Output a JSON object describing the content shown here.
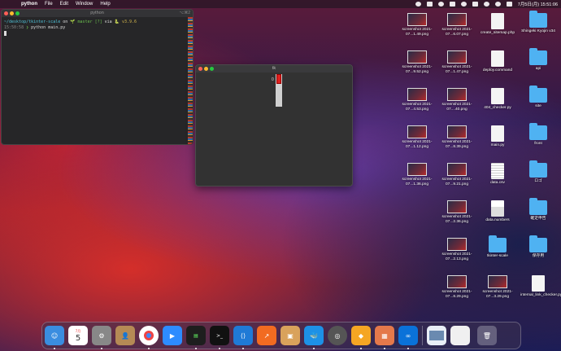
{
  "menubar": {
    "app": "python",
    "items": [
      "File",
      "Edit",
      "Window",
      "Help"
    ],
    "clock": "7月5日(月) 15:51:06"
  },
  "terminal": {
    "title": "python",
    "shortcut": "⌥⌘2",
    "line1": {
      "path": "~/desktop/tkinter-scale",
      "on": " on ",
      "branch": "🌱 master [?]",
      "via": " via ",
      "py": "🐍 v3.9.6"
    },
    "line2": {
      "time": "15:50:58",
      "prompt": " ❯ ",
      "cmd": "python main.py"
    }
  },
  "tk": {
    "title": "tk",
    "scale_value": "0",
    "scale_fraction": 0
  },
  "icons": [
    {
      "label": "screenshot 2021-07...1.49.png",
      "type": "thumb"
    },
    {
      "label": "screenshot 2021-07...6.07.png",
      "type": "thumb"
    },
    {
      "label": "create_sitemap.php",
      "type": "doc"
    },
    {
      "label": "Shingeki Kyojin v34",
      "type": "folder"
    },
    {
      "label": "screenshot 2021-07...9.52.png",
      "type": "thumb"
    },
    {
      "label": "screenshot 2021-07...1.47.png",
      "type": "thumb"
    },
    {
      "label": "deploy.command",
      "type": "doc"
    },
    {
      "label": "api",
      "type": "folder"
    },
    {
      "label": "screenshot 2021-07...4.53.png",
      "type": "thumb"
    },
    {
      "label": "screenshot 2021-07....40.png",
      "type": "thumb"
    },
    {
      "label": "404_checker.py",
      "type": "doc"
    },
    {
      "label": "site",
      "type": "folder"
    },
    {
      "label": "screenshot 2021-07...1.12.png",
      "type": "thumb"
    },
    {
      "label": "screenshot 2021-07...8.39.png",
      "type": "thumb"
    },
    {
      "label": "main.py",
      "type": "doc"
    },
    {
      "label": "front",
      "type": "folder"
    },
    {
      "label": "screenshot 2021-07...1.36.png",
      "type": "thumb"
    },
    {
      "label": "screenshot 2021-07...9.21.png",
      "type": "thumb"
    },
    {
      "label": "data.csv",
      "type": "spread"
    },
    {
      "label": "ロゴ",
      "type": "folder"
    },
    {
      "label": "screenshot 2021-07...2.36.png",
      "type": "thumb"
    },
    {
      "label": "data.numbers",
      "type": "numbers"
    },
    {
      "label": "確定申告",
      "type": "folder"
    },
    {
      "label": "screenshot 2021-07...2.13.png",
      "type": "thumb"
    },
    {
      "label": "tkinter-scale",
      "type": "folder"
    },
    {
      "label": "保存用",
      "type": "folder"
    },
    {
      "label": "screenshot 2021-07...8.29.png",
      "type": "thumb"
    },
    {
      "label": "screenshot 2021-07...3.29.png",
      "type": "thumb"
    },
    {
      "label": "internal_link_checker.py",
      "type": "doc"
    }
  ],
  "dock": {
    "calendar_month": "7月",
    "calendar_day": "5"
  }
}
